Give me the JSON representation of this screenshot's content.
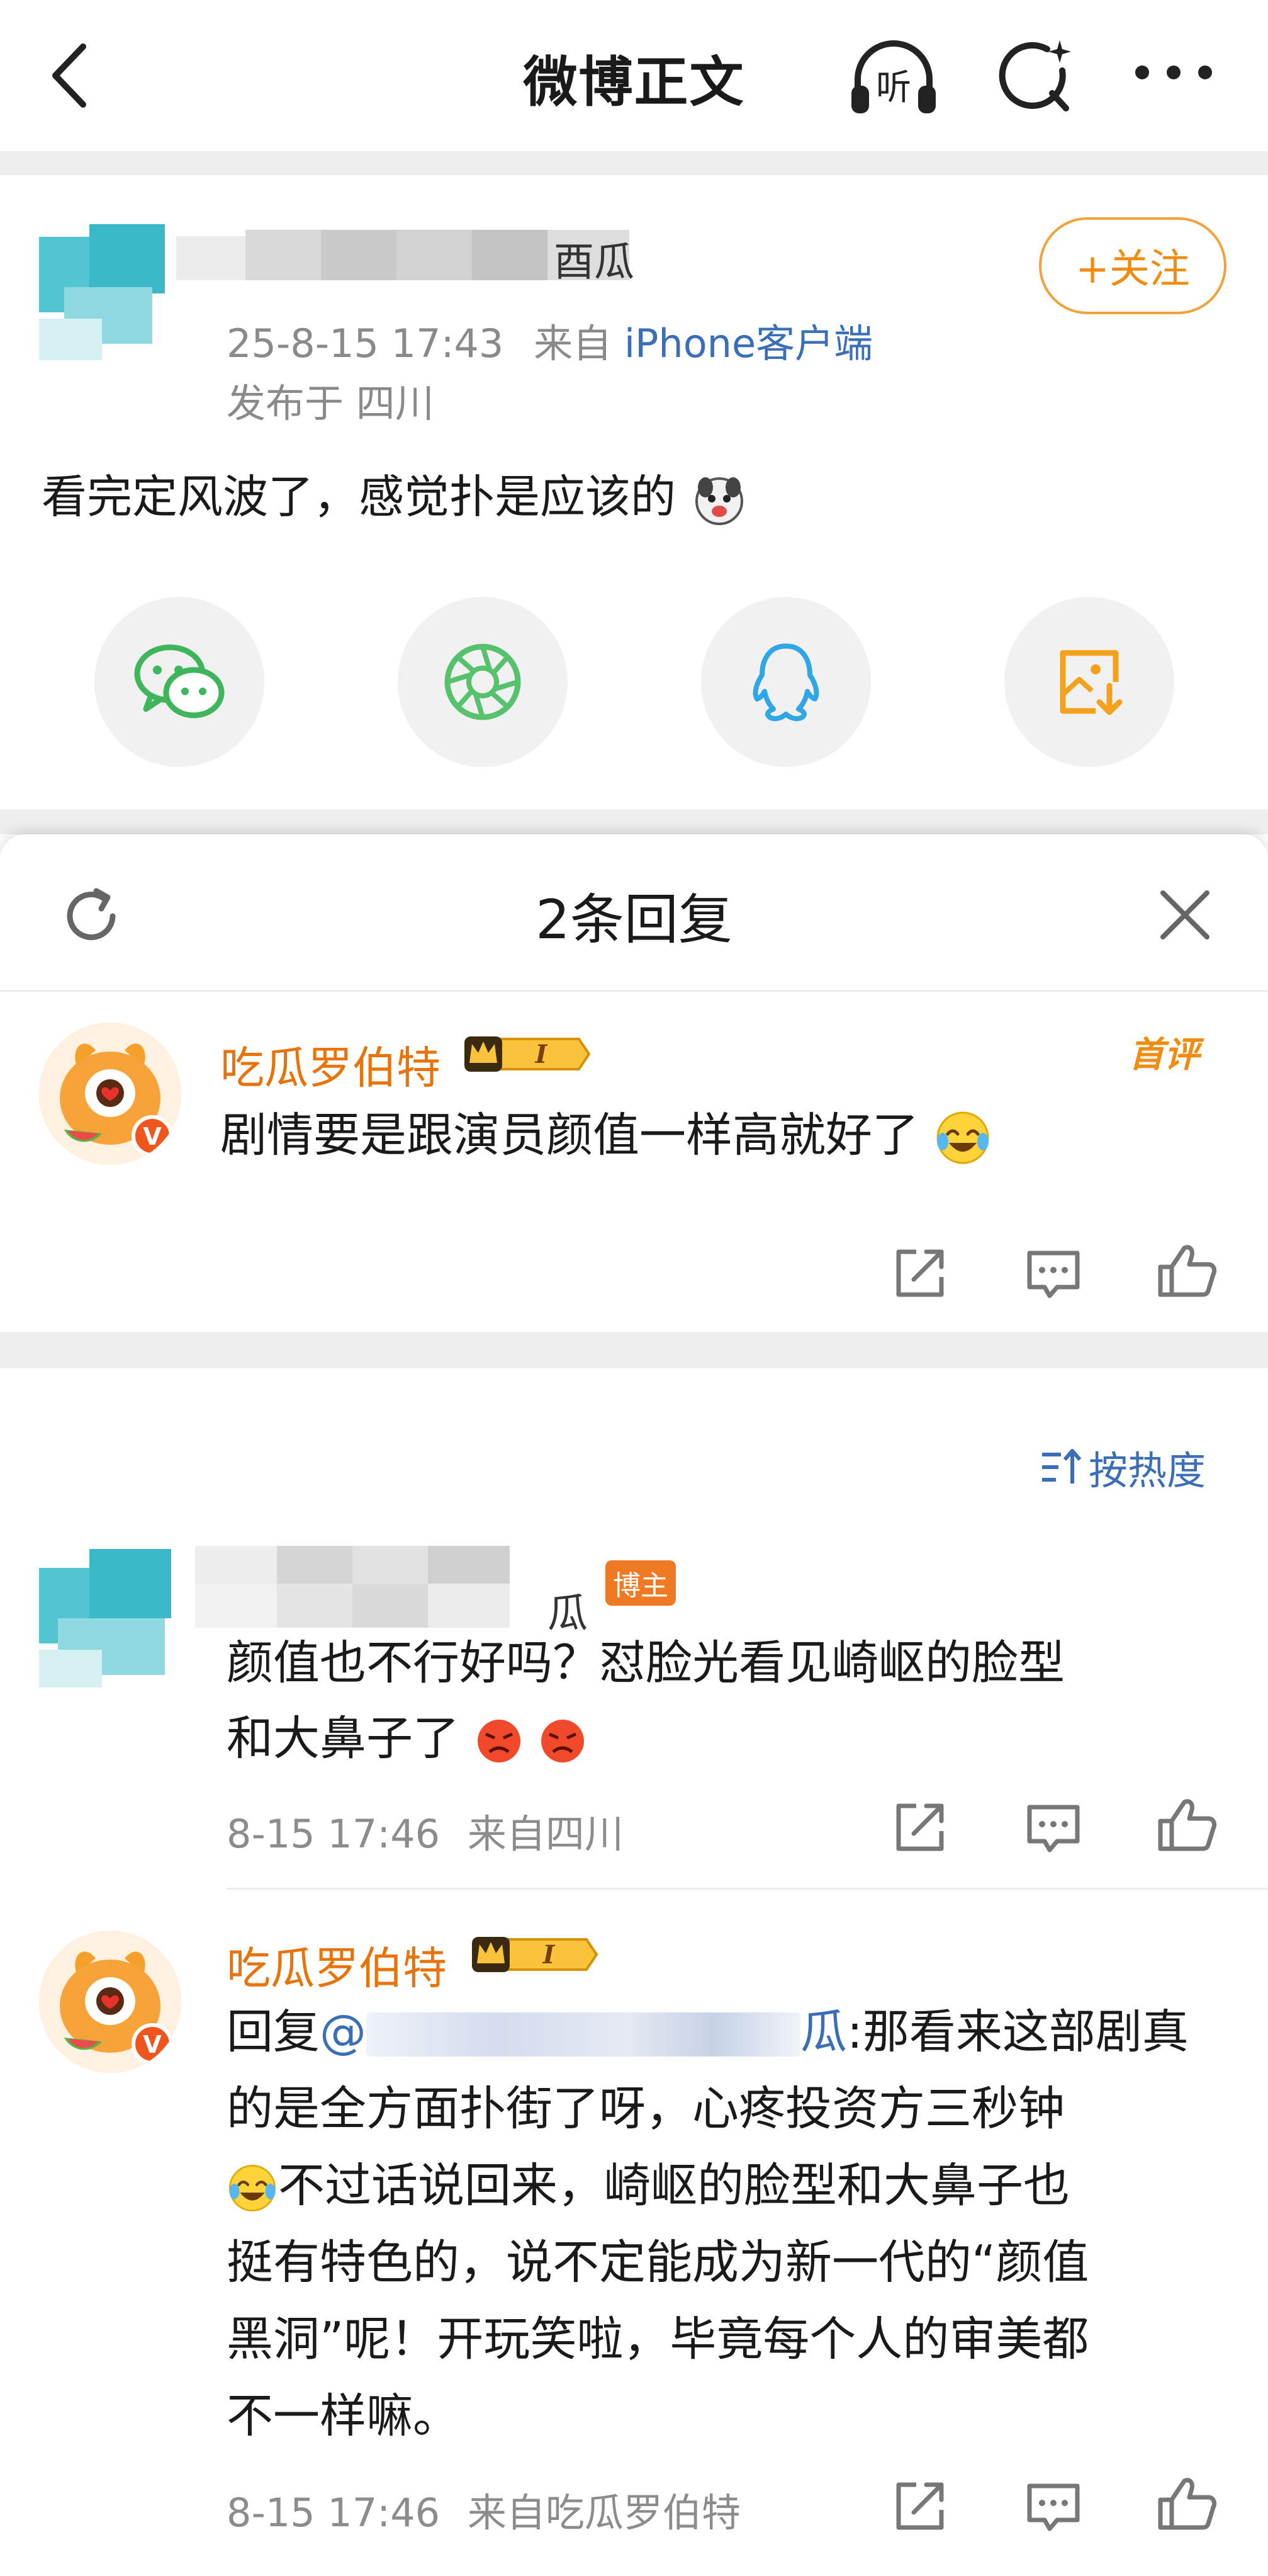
{
  "nav": {
    "title": "微博正文",
    "listen_label": "听"
  },
  "post": {
    "username_fragment": "酉瓜",
    "follow_label": "+关注",
    "time": "25-8-15 17:43",
    "from_prefix": "来自",
    "source": "iPhone客户端",
    "location": "发布于 四川",
    "text": "看完定风波了，感觉扑是应该的",
    "share": [
      "wechat-icon",
      "moments-icon",
      "qq-icon",
      "save-image-icon"
    ]
  },
  "sheet": {
    "title": "2条回复"
  },
  "first_reply": {
    "username": "吃瓜罗伯特",
    "vip_level": "I",
    "tag": "首评",
    "text": "剧情要是跟演员颜值一样高就好了"
  },
  "sort": {
    "label": "按热度"
  },
  "comments": [
    {
      "username_fragment": "瓜",
      "badge": "博主",
      "line1": "颜值也不行好吗？怼脸光看见崎岖的脸型",
      "line2": "和大鼻子了",
      "time": "8-15 17:46",
      "from": "来自四川"
    },
    {
      "username": "吃瓜罗伯特",
      "vip_level": "I",
      "reply_prefix": "回复",
      "mention": "@",
      "mention_tail": "瓜",
      "line1_rest": ":那看来这部剧真",
      "line2": "的是全方面扑街了呀，心疼投资方三秒钟",
      "line3": "不过话说回来，崎岖的脸型和大鼻子也",
      "line4": "挺有特色的，说不定能成为新一代的“颜值",
      "line5": "黑洞”呢！开玩笑啦，毕竟每个人的审美都",
      "line6": "不一样嘛。",
      "time": "8-15 17:46",
      "from": "来自吃瓜罗伯特"
    }
  ],
  "colors": {
    "accent_orange": "#f28c0f",
    "link_blue": "#3a6fb8",
    "username_orange": "#e87308"
  }
}
